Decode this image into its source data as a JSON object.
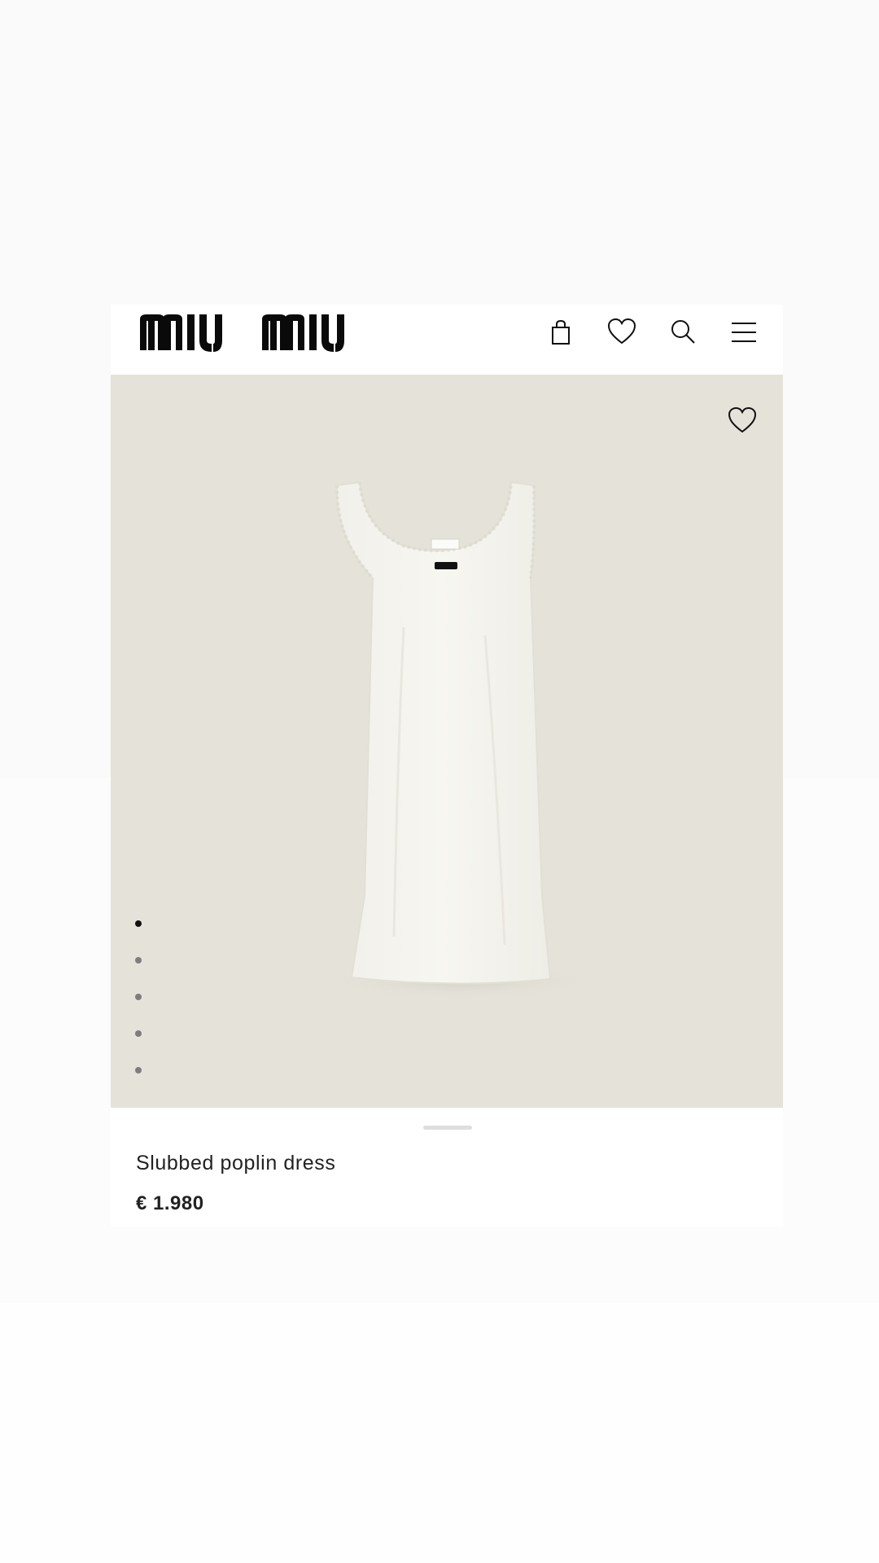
{
  "header": {
    "logo_text": "miu miu",
    "icons": [
      "shopping-bag-icon",
      "heart-icon",
      "search-icon",
      "menu-icon"
    ]
  },
  "product": {
    "name": "Slubbed poplin dress",
    "price": "€ 1.980",
    "image_alt": "Slubbed poplin dress",
    "gallery": {
      "count": 5,
      "active_index": 0
    }
  },
  "colors": {
    "image_background": "#e5e2d9",
    "text": "#222222",
    "dot_active": "#111111",
    "dot_inactive": "#7d7d7d"
  }
}
